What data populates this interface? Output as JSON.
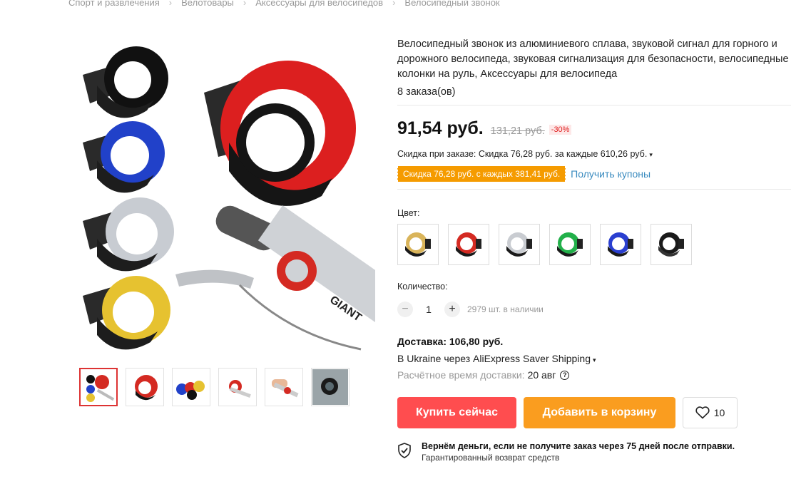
{
  "breadcrumb": [
    "Спорт и развлечения",
    "Велотовары",
    "Аксессуары для велосипедов",
    "Велосипедный звонок"
  ],
  "product": {
    "title": "Велосипедный звонок из алюминиевого сплава, звуковой сигнал для горного и дорожного велосипеда, звуковая сигнализация для безопасности, велосипедные колонки на руль, Аксессуары для велосипеда",
    "orders": "8 заказа(ов)"
  },
  "price": {
    "current": "91,54 руб.",
    "old": "131,21 руб.",
    "discount": "-30%"
  },
  "order_discount": "Скидка при заказе: Скидка 76,28 руб. за каждые 610,26 руб.",
  "coupon": {
    "tag": "Скидка 76,28 руб. с каждых 381,41 руб.",
    "link": "Получить купоны"
  },
  "color": {
    "label": "Цвет:",
    "options": [
      "gold",
      "red",
      "silver",
      "green",
      "blue",
      "black"
    ],
    "colors": [
      "#d9b45a",
      "#d42a22",
      "#c9ccd1",
      "#22b04a",
      "#2a3fd0",
      "#1a1a1a"
    ]
  },
  "quantity": {
    "label": "Количество:",
    "value": "1",
    "minus": "−",
    "plus": "+",
    "stock": "2979 шт. в наличии"
  },
  "delivery": {
    "cost": "Доставка: 106,80 руб.",
    "via": "В Ukraine через AliExpress Saver Shipping",
    "eta_label": "Расчётное время доставки:",
    "eta_date": "20 авг",
    "help": "?"
  },
  "actions": {
    "buy": "Купить сейчас",
    "cart": "Добавить в корзину",
    "wish_count": "10"
  },
  "guarantee": {
    "title": "Вернём деньги, если не получите заказ через 75 дней после отправки.",
    "subtitle": "Гарантированный возврат средств"
  },
  "thumbnails": [
    "bells-collage",
    "red-bell",
    "multicolor-bells",
    "bell-on-bike",
    "hand-on-handlebar",
    "bell-closeup"
  ]
}
